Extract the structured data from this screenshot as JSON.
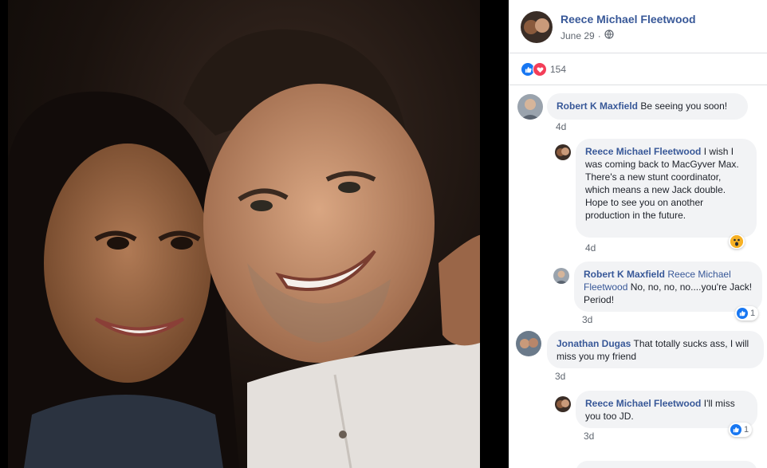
{
  "post": {
    "author": "Reece Michael Fleetwood",
    "date": "June 29",
    "dot": "·",
    "privacy_icon": "globe-icon",
    "reaction_count": "154"
  },
  "comments": [
    {
      "name": "Robert K Maxfield",
      "text": "Be seeing you soon!",
      "time": "4d"
    },
    {
      "name": "Reece Michael Fleetwood",
      "text": "I wish I was coming back to MacGyver Max. There's a new stunt coordinator, which means a new Jack double.",
      "text2": "Hope to see you on another production in the future.",
      "time": "4d"
    },
    {
      "name": "Robert K Maxfield",
      "mention": "Reece Michael Fleetwood",
      "text": "No, no, no, no....you're Jack! Period!",
      "time": "3d",
      "likes": "1"
    },
    {
      "name": "Jonathan Dugas",
      "text": "That totally sucks ass, I will miss you my friend",
      "time": "3d"
    },
    {
      "name": "Reece Michael Fleetwood",
      "text": "I'll miss you too JD.",
      "time": "3d",
      "likes": "1"
    }
  ],
  "colors": {
    "link": "#385898",
    "bubble": "#f2f3f5",
    "like": "#1877f2",
    "love": "#f33e58"
  }
}
